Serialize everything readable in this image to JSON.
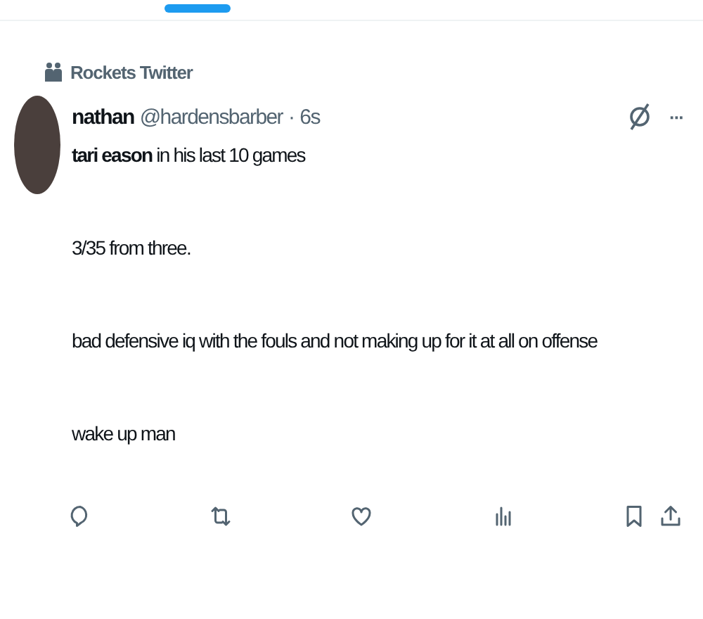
{
  "community": {
    "name": "Rockets Twitter"
  },
  "post": {
    "author": "nathan",
    "handle": "@hardensbarber",
    "separator": "·",
    "time": "6s",
    "more": "···",
    "paragraphs": [
      "**tari eason** in his last 10 games",
      "3/35 from three.",
      "bad defensive iq with the fouls and not making up for it at all on offense",
      "wake up man"
    ]
  },
  "actions": [
    {
      "kind": "reply"
    },
    {
      "kind": "repost"
    },
    {
      "kind": "like"
    },
    {
      "kind": "views"
    },
    {
      "kind": "bookmark"
    },
    {
      "kind": "share"
    }
  ]
}
